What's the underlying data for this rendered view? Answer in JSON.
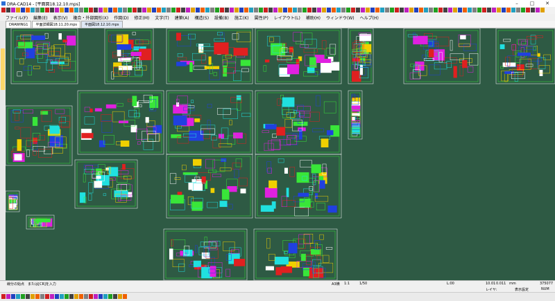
{
  "window": {
    "title": "DRA-CAD14 - [平面図18.12.10.mps]",
    "min": "–",
    "max": "□",
    "close": "✕"
  },
  "menu": [
    "ファイル(F)",
    "編集(E)",
    "表示(V)",
    "複合・外部図形(X)",
    "作図(D)",
    "修正(M)",
    "文字(T)",
    "建築(A)",
    "構造(S)",
    "設備(B)",
    "施工(K)",
    "属性(P)",
    "レイアウト(L)",
    "補助(H)",
    "ウィンドウ(W)",
    "ヘルプ(H)"
  ],
  "tabs": [
    {
      "label": "DRAWING1"
    },
    {
      "label": "平面詳細図18.11.20.mps"
    },
    {
      "label": "平面図18.12.10.mps"
    }
  ],
  "status": {
    "hint": "線分の始点　または[CR]を入力",
    "scale_label": "A3横",
    "scale_ratio": "1:1",
    "scale_value": "1/50",
    "layer": "L:00",
    "coord_x": "10.01",
    "coord_y": "0.011",
    "unit": "mm",
    "zoom": "375077",
    "layer2": "レイヤ:",
    "display": "表示設定",
    "num": "NUM"
  },
  "colors": {
    "canvas": "#2e5a44",
    "drawing_line": "#39e639",
    "accent_red": "#e02020",
    "accent_blue": "#2040e0",
    "accent_yellow": "#f0d000",
    "accent_magenta": "#e020e0"
  }
}
